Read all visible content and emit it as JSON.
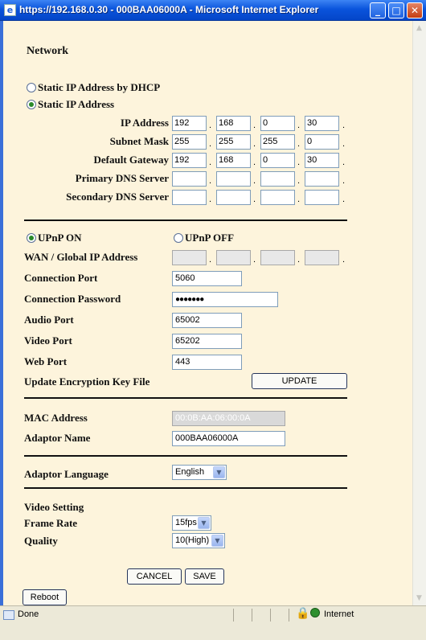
{
  "window": {
    "title": "https://192.168.0.30 - 000BAA06000A - Microsoft Internet Explorer",
    "icon": "ie-page-icon",
    "minimize": "_",
    "maximize": "□",
    "close": "✕"
  },
  "page": {
    "heading": "Network",
    "ip_mode": {
      "dhcp_label": "Static IP Address by DHCP",
      "static_label": "Static IP Address",
      "selected": "static"
    },
    "ip_fields": [
      {
        "label": "IP Address",
        "octets": [
          "192",
          "168",
          "0",
          "30"
        ]
      },
      {
        "label": "Subnet Mask",
        "octets": [
          "255",
          "255",
          "255",
          "0"
        ]
      },
      {
        "label": "Default Gateway",
        "octets": [
          "192",
          "168",
          "0",
          "30"
        ]
      },
      {
        "label": "Primary DNS Server",
        "octets": [
          "",
          "",
          "",
          ""
        ]
      },
      {
        "label": "Secondary DNS Server",
        "octets": [
          "",
          "",
          "",
          ""
        ]
      }
    ],
    "upnp": {
      "on_label": "UPnP ON",
      "off_label": "UPnP OFF",
      "selected": "on"
    },
    "wan": {
      "label": "WAN / Global IP Address",
      "octets": [
        "",
        "",
        "",
        ""
      ]
    },
    "connection_port": {
      "label": "Connection Port",
      "value": "5060"
    },
    "connection_password": {
      "label": "Connection Password",
      "value": "●●●●●●●"
    },
    "audio_port": {
      "label": "Audio Port",
      "value": "65002"
    },
    "video_port": {
      "label": "Video Port",
      "value": "65202"
    },
    "web_port": {
      "label": "Web Port",
      "value": "443"
    },
    "encryption": {
      "label": "Update Encryption Key File",
      "button": "UPDATE"
    },
    "mac": {
      "label": "MAC Address",
      "value": "00:0B:AA:06:00:0A"
    },
    "adaptor_name": {
      "label": "Adaptor Name",
      "value": "000BAA06000A"
    },
    "adaptor_language": {
      "label": "Adaptor Language",
      "value": "English"
    },
    "video_setting": {
      "heading": "Video Setting",
      "frame_rate_label": "Frame Rate",
      "frame_rate": "15fps",
      "quality_label": "Quality",
      "quality": "10(High)"
    },
    "buttons": {
      "cancel": "CANCEL",
      "save": "SAVE",
      "reboot": "Reboot"
    }
  },
  "statusbar": {
    "text": "Done",
    "zone": "Internet"
  },
  "colors": {
    "titlebar": "#0a54dc",
    "content_bg": "#fdf4dc",
    "radio_selected": "#2a8a2a"
  }
}
